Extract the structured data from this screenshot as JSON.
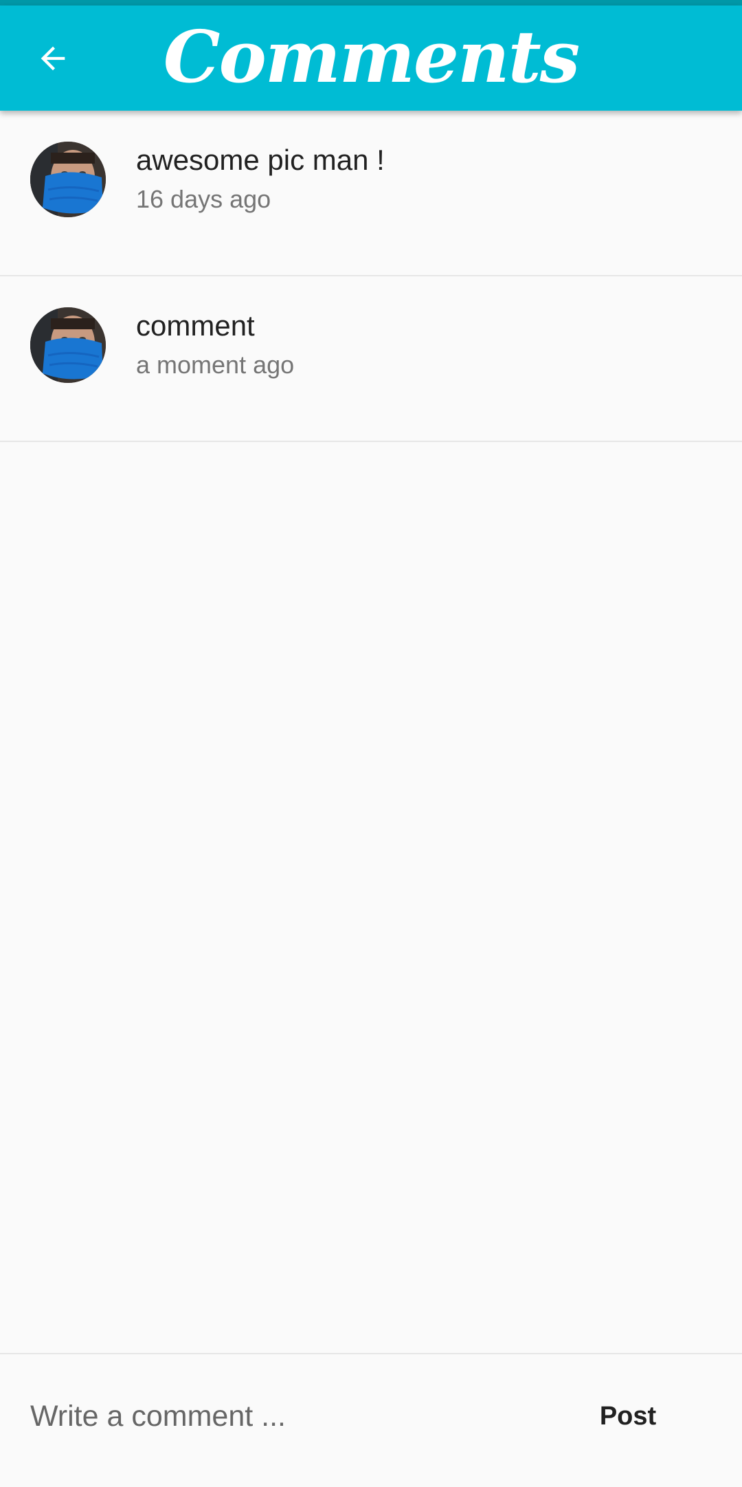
{
  "app_bar": {
    "title": "Comments",
    "back_icon": "arrow-back-icon",
    "background_color": "#00bcd4",
    "status_strip_color": "#0097a7"
  },
  "comments": [
    {
      "text": "awesome pic man !",
      "time": "16 days ago",
      "avatar_icon": "user-avatar"
    },
    {
      "text": "comment",
      "time": "a moment ago",
      "avatar_icon": "user-avatar"
    }
  ],
  "composer": {
    "placeholder": "Write a comment ...",
    "value": "",
    "post_label": "Post"
  }
}
